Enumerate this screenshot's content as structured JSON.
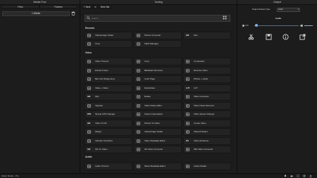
{
  "panels": {
    "media_pool": "Media Pool",
    "tooling": "Tooling",
    "output": "Output"
  },
  "media_pool": {
    "tabs": [
      "Files",
      "Folders"
    ],
    "field_value": "1 Media"
  },
  "tool_tabs": [
    {
      "label": "New"
    },
    {
      "label": "New Tab"
    }
  ],
  "search": {
    "placeholder": "Search"
  },
  "sections": {
    "recents": "Recents",
    "video": "Video",
    "audio": "Audio"
  },
  "recents": [
    {
      "label": "Video/Image Scaler",
      "icon": "expand-icon"
    },
    {
      "label": "Picture Converter",
      "icon": "image-icon"
    },
    {
      "label": "GIG",
      "icon": "gif-text-icon"
    },
    {
      "label": "Crop",
      "icon": "crop-icon"
    },
    {
      "label": "Flash Manager",
      "icon": "flash-icon"
    }
  ],
  "video": [
    {
      "label": "Video Trimmer",
      "icon": "scissors-icon"
    },
    {
      "label": "Crop",
      "icon": "crop-icon"
    },
    {
      "label": "Compositor",
      "icon": "layers-icon"
    },
    {
      "label": "Extract Frame",
      "icon": "frame-icon"
    },
    {
      "label": "Blackbars Remover",
      "icon": "bars-icon"
    },
    {
      "label": "Reverse Video",
      "icon": "reverse-icon"
    },
    {
      "label": "Blur And Sharpening",
      "icon": "blur-icon"
    },
    {
      "label": "Color Page",
      "icon": "palette-icon"
    },
    {
      "label": "Picture + Audio",
      "icon": "picture-audio-icon"
    },
    {
      "label": "Video + Video",
      "icon": "plus-icon"
    },
    {
      "label": "Deinterlace",
      "icon": "deinterlace-icon"
    },
    {
      "label": "LUT",
      "icon": "lut-text-icon"
    },
    {
      "label": "GIG",
      "icon": "gif-text-icon"
    },
    {
      "label": "Rotate",
      "icon": "rotate-icon"
    },
    {
      "label": "Video Converter",
      "icon": "convert-icon"
    },
    {
      "label": "Vignette",
      "icon": "vignette-icon"
    },
    {
      "label": "Video Noise Adder",
      "icon": "noise-icon"
    },
    {
      "label": "Video Noise Remover",
      "icon": "denoise-icon"
    },
    {
      "label": "Simple FPS Changer",
      "icon": "fps-text-icon"
    },
    {
      "label": "Frame Interpolation",
      "icon": "interpolation-icon"
    },
    {
      "label": "Video Speed Changer",
      "icon": "speed-icon"
    },
    {
      "label": "Video To Gif",
      "icon": "video-gif-text-icon"
    },
    {
      "label": "Picture To Video",
      "icon": "picture-video-icon"
    },
    {
      "label": "Create Video",
      "icon": "create-video-icon"
    },
    {
      "label": "Flipper",
      "icon": "flip-icon"
    },
    {
      "label": "Video/Image Scaler",
      "icon": "expand-icon"
    },
    {
      "label": "Video/4 Detect",
      "icon": "detect-icon"
    },
    {
      "label": "Vidcode Transform",
      "icon": "transform-icon"
    },
    {
      "label": "Video Metadata Editor",
      "icon": "metadata-icon"
    },
    {
      "label": "Video Enhancer",
      "icon": "photo-text-icon"
    },
    {
      "label": "GIF To Video",
      "icon": "gif-video-text-icon"
    },
    {
      "label": "3D Video Converter",
      "icon": "3d-icon"
    },
    {
      "label": "360 Video Converter",
      "icon": "360-icon"
    }
  ],
  "audio": [
    {
      "label": "Audio Trimmer",
      "icon": "scissors-icon"
    },
    {
      "label": "Music Metadata Editor",
      "icon": "music-icon"
    },
    {
      "label": "Audio Padder",
      "icon": "padder-icon"
    }
  ],
  "output": {
    "stream_type_label": "Output Stream Type:",
    "stream_type_value": "Audio",
    "media_title": "Audio",
    "time": "0:00",
    "progress": 0.05
  },
  "status": {
    "app_name": "Glaze Studio - Pro"
  },
  "colors": {
    "background": "#1c1c1c",
    "panel": "#232323",
    "accent": "#7fb0e6"
  }
}
